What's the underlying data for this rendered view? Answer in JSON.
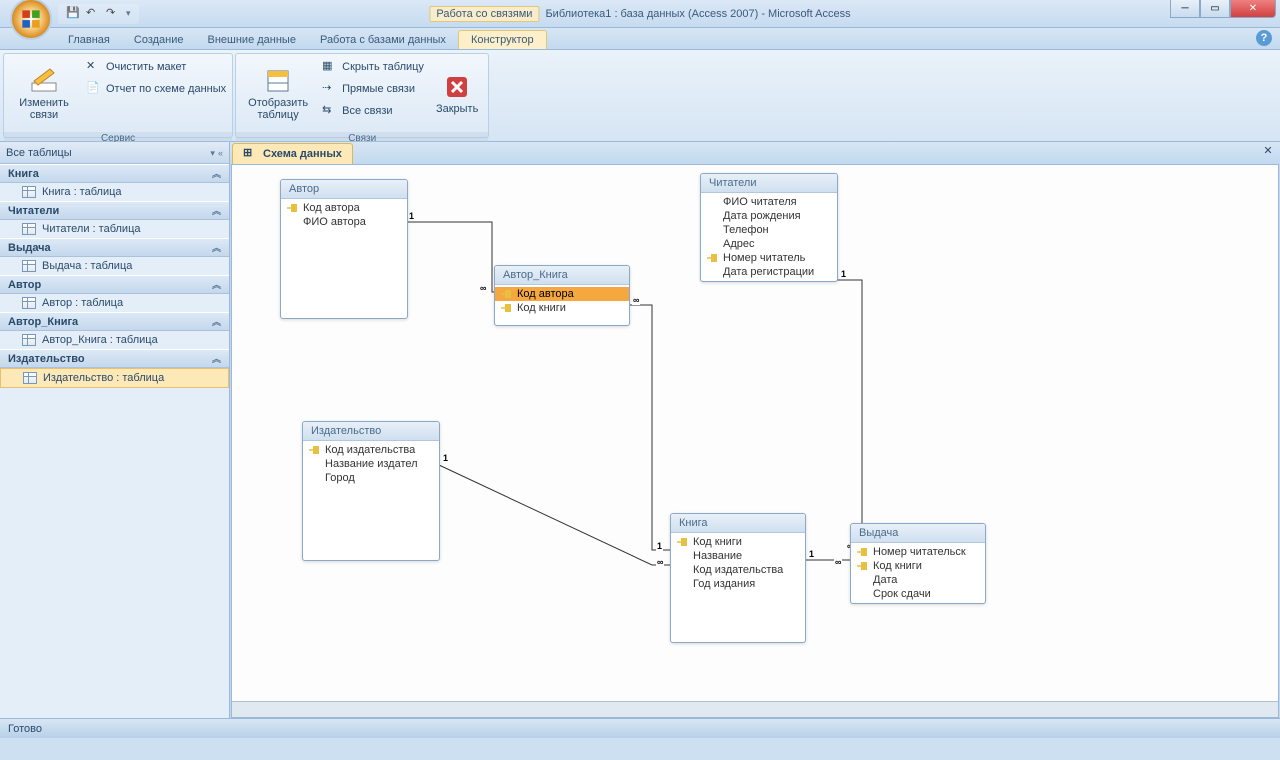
{
  "title": {
    "context": "Работа со связями",
    "doc": "Библиотека1 : база данных (Access 2007) - Microsoft Access"
  },
  "tabs": {
    "t1": "Главная",
    "t2": "Создание",
    "t3": "Внешние данные",
    "t4": "Работа с базами данных",
    "t5": "Конструктор"
  },
  "ribbon": {
    "g1": {
      "label": "Сервис",
      "btn_edit": "Изменить связи",
      "btn_clear": "Очистить макет",
      "btn_report": "Отчет по схеме данных"
    },
    "g2": {
      "label": "Связи",
      "btn_show": "Отобразить таблицу",
      "btn_hide": "Скрыть таблицу",
      "btn_direct": "Прямые связи",
      "btn_all": "Все связи",
      "btn_close": "Закрыть"
    }
  },
  "nav": {
    "header": "Все таблицы",
    "groups": [
      {
        "name": "Книга",
        "items": [
          "Книга : таблица"
        ]
      },
      {
        "name": "Читатели",
        "items": [
          "Читатели : таблица"
        ]
      },
      {
        "name": "Выдача",
        "items": [
          "Выдача : таблица"
        ]
      },
      {
        "name": "Автор",
        "items": [
          "Автор : таблица"
        ]
      },
      {
        "name": "Автор_Книга",
        "items": [
          "Автор_Книга : таблица"
        ]
      },
      {
        "name": "Издательство",
        "items": [
          "Издательство : таблица"
        ]
      }
    ]
  },
  "doctab": "Схема данных",
  "tables": {
    "avtor": {
      "title": "Автор",
      "fields": [
        {
          "n": "Код автора",
          "k": true
        },
        {
          "n": "ФИО автора"
        }
      ]
    },
    "avtor_kniga": {
      "title": "Автор_Книга",
      "fields": [
        {
          "n": "Код автора",
          "k": true,
          "sel": true
        },
        {
          "n": "Код книги",
          "k": true
        }
      ]
    },
    "chitateli": {
      "title": "Читатели",
      "fields": [
        {
          "n": "ФИО читателя"
        },
        {
          "n": "Дата рождения"
        },
        {
          "n": "Телефон"
        },
        {
          "n": "Адрес"
        },
        {
          "n": "Номер  читатель",
          "k": true
        },
        {
          "n": "Дата регистрации"
        }
      ]
    },
    "izdatelstvo": {
      "title": "Издательство",
      "fields": [
        {
          "n": "Код издательства",
          "k": true
        },
        {
          "n": "Название издател"
        },
        {
          "n": "Город"
        }
      ]
    },
    "kniga": {
      "title": "Книга",
      "fields": [
        {
          "n": "Код книги",
          "k": true
        },
        {
          "n": "Название"
        },
        {
          "n": "Код издательства"
        },
        {
          "n": "Год издания"
        }
      ]
    },
    "vydacha": {
      "title": "Выдача",
      "fields": [
        {
          "n": "Номер читательск",
          "k": true
        },
        {
          "n": "Код книги",
          "k": true
        },
        {
          "n": "Дата"
        },
        {
          "n": "Срок сдачи"
        }
      ]
    }
  },
  "status": "Готово"
}
